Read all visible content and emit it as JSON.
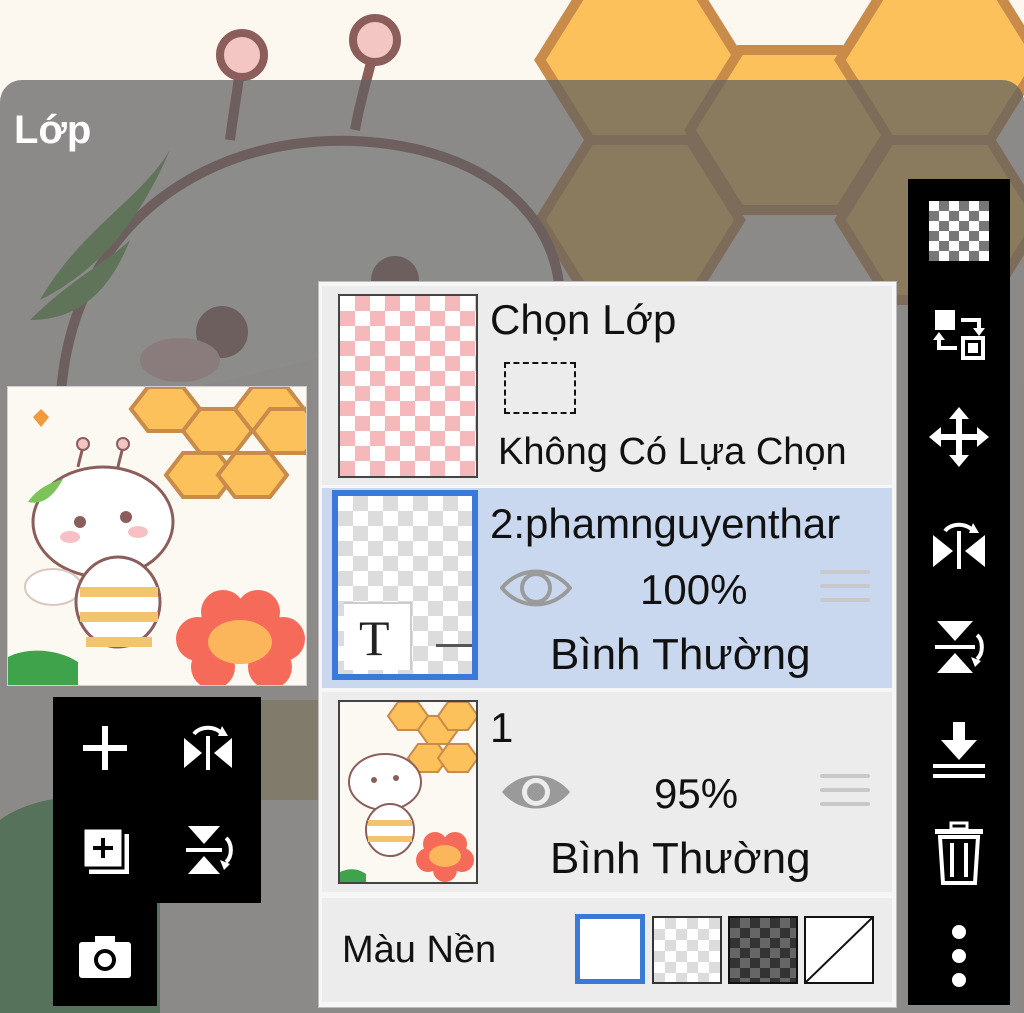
{
  "panel": {
    "title": "Lớp"
  },
  "selection_row": {
    "title": "Chọn Lớp",
    "status": "Không Có Lựa Chọn"
  },
  "layers": [
    {
      "name": "2:phamnguyenthar",
      "opacity": "100%",
      "blend": "Bình Thường",
      "selected": true,
      "visible": true,
      "type": "text"
    },
    {
      "name": "1",
      "opacity": "95%",
      "blend": "Bình Thường",
      "selected": false,
      "visible": true,
      "type": "image"
    }
  ],
  "background": {
    "label": "Màu Nền",
    "options": [
      "white",
      "transparent",
      "dark-checker",
      "none"
    ],
    "selected": "white"
  },
  "left_toolbar": {
    "icons": [
      "add-icon",
      "flip-horizontal-icon",
      "add-copy-icon",
      "flip-vertical-icon",
      "camera-icon"
    ]
  },
  "right_toolbar": {
    "icons": [
      "transparency-checker-icon",
      "swap-layers-icon",
      "move-icon",
      "flip-horizontal-icon",
      "flip-vertical-icon",
      "merge-down-icon",
      "trash-icon",
      "more-vertical-icon"
    ]
  },
  "colors": {
    "accent": "#3a79d8",
    "selected_row": "#c9d8ee",
    "toolbar": "#000000"
  }
}
